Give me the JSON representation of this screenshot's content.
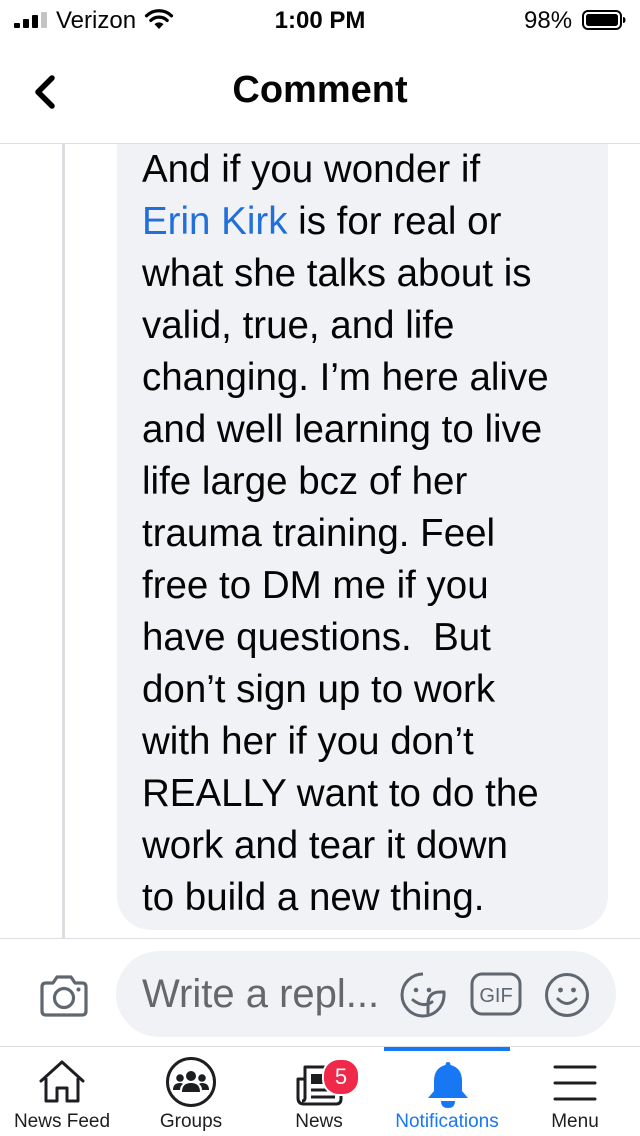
{
  "status_bar": {
    "carrier": "Verizon",
    "time": "1:00 PM",
    "battery_percent": "98%",
    "icons": [
      "signal-bars-icon",
      "wifi-icon",
      "battery-icon"
    ]
  },
  "header": {
    "title": "Comment",
    "back_icon": "chevron-left-icon"
  },
  "comment": {
    "text_before_mention": "And if you wonder if\n",
    "mention": "Erin Kirk",
    "text_after_mention": " is for real or\nwhat she talks about is\nvalid, true, and life\nchanging. I’m here alive\nand well learning to live\nlife large bcz of her\ntrauma training. Feel\nfree to DM me if you\nhave questions.  But\ndon’t sign up to work\nwith her if you don’t\nREALLY want to do the\nwork and tear it down\nto build a new thing."
  },
  "reply": {
    "placeholder": "Write a repl...",
    "camera_icon": "camera-icon",
    "sticker_icon": "sticker-icon",
    "gif_label": "GIF",
    "emoji_icon": "emoji-icon"
  },
  "tab_bar": {
    "tabs": [
      {
        "label": "News Feed",
        "icon": "home-icon",
        "active": false
      },
      {
        "label": "Groups",
        "icon": "groups-icon",
        "active": false
      },
      {
        "label": "News",
        "icon": "news-icon",
        "active": false,
        "badge": "5"
      },
      {
        "label": "Notifications",
        "icon": "bell-icon",
        "active": true
      },
      {
        "label": "Menu",
        "icon": "hamburger-menu-icon",
        "active": false
      }
    ]
  },
  "colors": {
    "accent": "#1877f2",
    "mention": "#216fdb",
    "bubble": "#f0f2f5",
    "badge": "#f02849"
  }
}
